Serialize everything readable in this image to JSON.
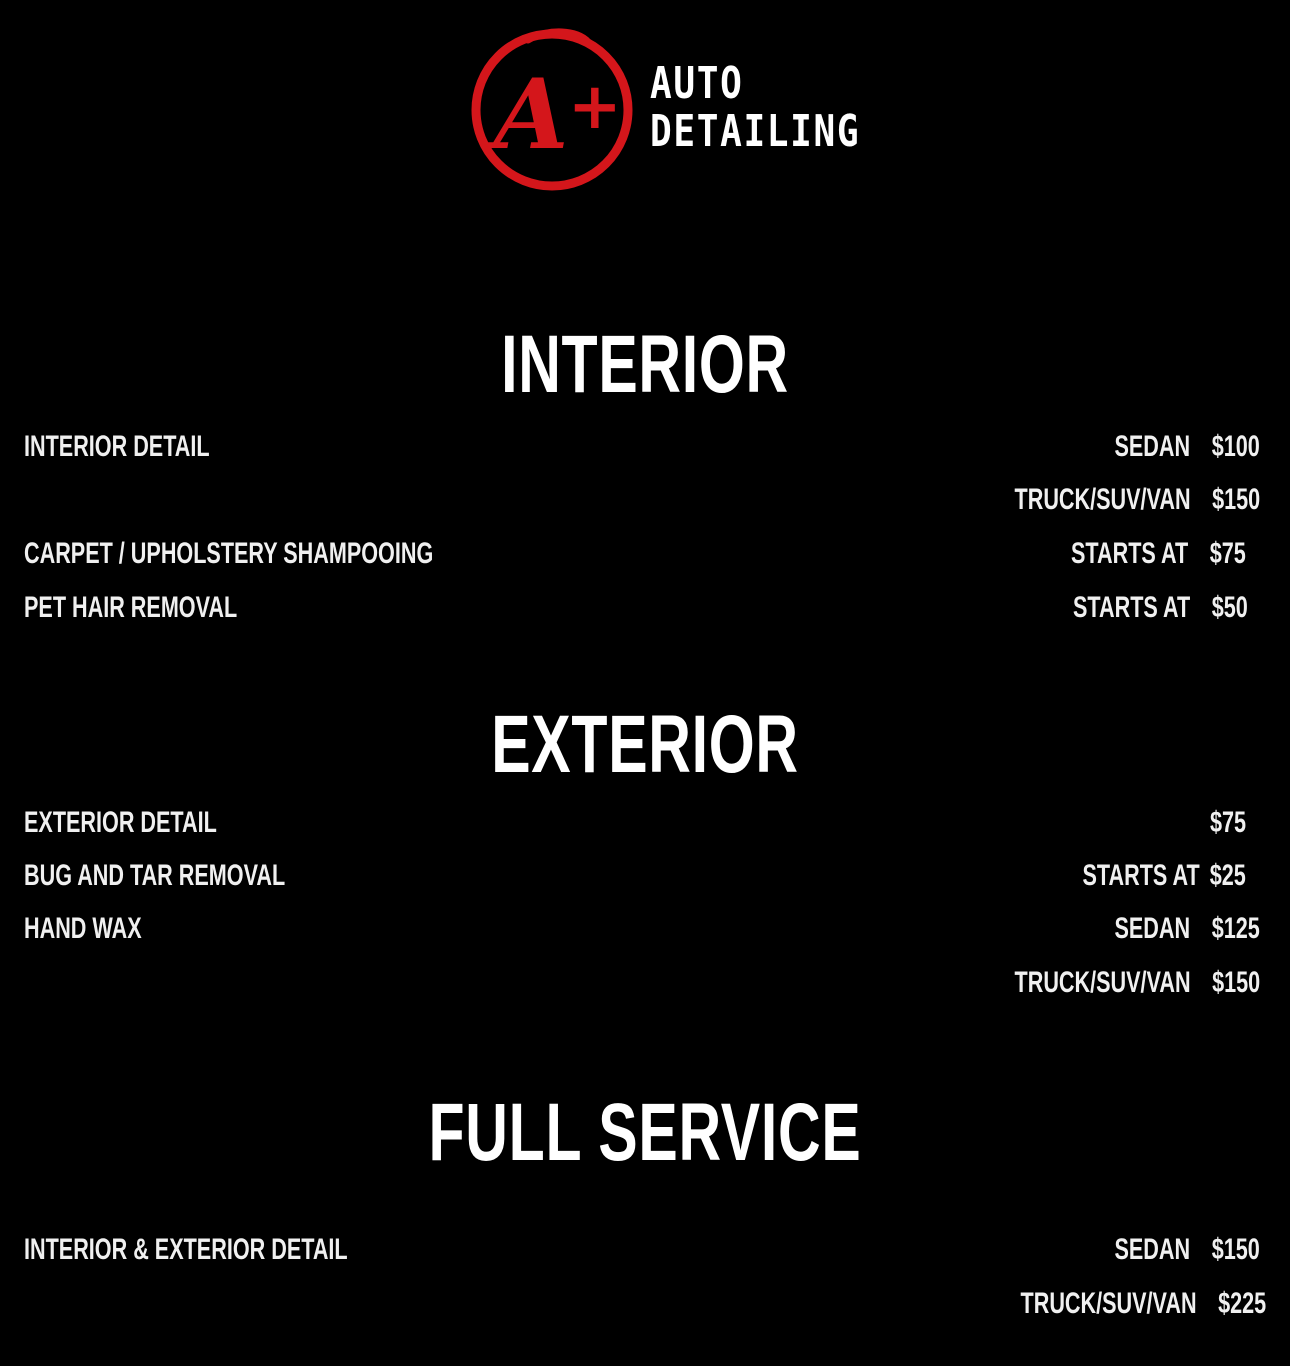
{
  "logo": {
    "mark_text": "A+",
    "line1": "AUTO",
    "line2": "DETAILING",
    "accent_color": "#d4161b"
  },
  "sections": {
    "interior": {
      "title": "INTERIOR",
      "rows": [
        {
          "name": "INTERIOR DETAIL",
          "label": "SEDAN",
          "price": "$100"
        },
        {
          "name": "",
          "label": "TRUCK/SUV/VAN",
          "price": "$150"
        },
        {
          "name": "CARPET / UPHOLSTERY SHAMPOOING",
          "label": "STARTS AT",
          "price": "$75"
        },
        {
          "name": "PET HAIR REMOVAL",
          "label": "STARTS AT",
          "price": "$50"
        }
      ]
    },
    "exterior": {
      "title": "EXTERIOR",
      "rows": [
        {
          "name": "EXTERIOR DETAIL",
          "label": "",
          "price": "$75"
        },
        {
          "name": "BUG AND TAR REMOVAL",
          "label": "STARTS AT",
          "price": "$25"
        },
        {
          "name": "HAND WAX",
          "label": "SEDAN",
          "price": "$125"
        },
        {
          "name": "",
          "label": "TRUCK/SUV/VAN",
          "price": "$150"
        }
      ]
    },
    "full_service": {
      "title": "FULL SERVICE",
      "rows": [
        {
          "name": "INTERIOR & EXTERIOR DETAIL",
          "label": "SEDAN",
          "price": "$150"
        },
        {
          "name": "",
          "label": "TRUCK/SUV/VAN",
          "price": "$225"
        }
      ]
    }
  }
}
